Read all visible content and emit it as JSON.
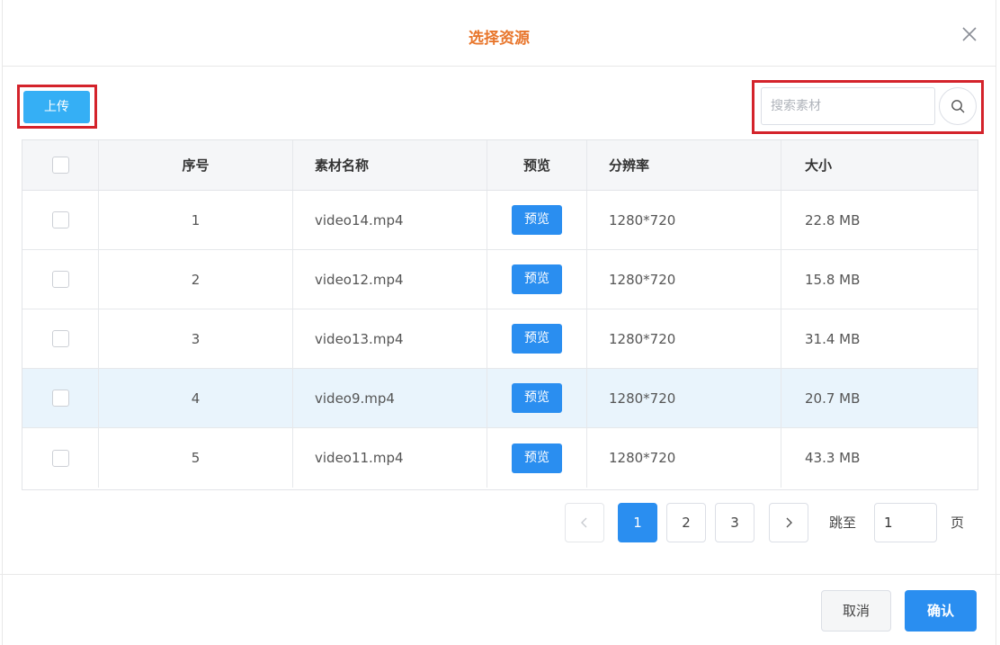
{
  "dialog": {
    "title": "选择资源",
    "close_icon": "close-icon"
  },
  "toolbar": {
    "upload_label": "上传",
    "search_placeholder": "搜索素材",
    "search_value": "",
    "search_icon": "search-icon"
  },
  "table": {
    "columns": [
      "序号",
      "素材名称",
      "预览",
      "分辨率",
      "大小"
    ],
    "rows": [
      {
        "index": "1",
        "name": "video14.mp4",
        "preview": "预览",
        "resolution": "1280*720",
        "size": "22.8 MB"
      },
      {
        "index": "2",
        "name": "video12.mp4",
        "preview": "预览",
        "resolution": "1280*720",
        "size": "15.8 MB"
      },
      {
        "index": "3",
        "name": "video13.mp4",
        "preview": "预览",
        "resolution": "1280*720",
        "size": "31.4 MB"
      },
      {
        "index": "4",
        "name": "video9.mp4",
        "preview": "预览",
        "resolution": "1280*720",
        "size": "20.7 MB"
      },
      {
        "index": "5",
        "name": "video11.mp4",
        "preview": "预览",
        "resolution": "1280*720",
        "size": "43.3 MB"
      }
    ],
    "highlighted_row": 4
  },
  "pagination": {
    "prev_icon": "chevron-left-icon",
    "pages": [
      "1",
      "2",
      "3"
    ],
    "current_page": "1",
    "next_icon": "chevron-right-icon",
    "jump_label": "跳至",
    "jump_value": "1",
    "page_suffix": "页"
  },
  "footer": {
    "cancel_label": "取消",
    "confirm_label": "确认"
  },
  "colors": {
    "title": "#e8762c",
    "primary": "#2a8ef0",
    "upload": "#35aff5",
    "highlight_box": "#d4232b"
  }
}
